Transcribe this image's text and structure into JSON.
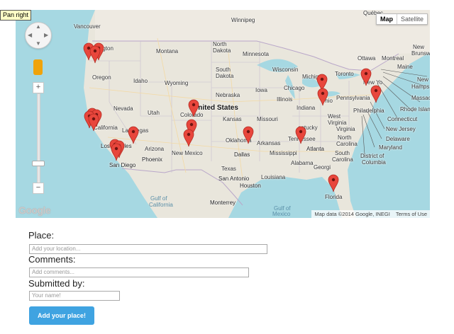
{
  "tooltip": "Pan right",
  "map": {
    "map_type_buttons": [
      "Map",
      "Satellite"
    ],
    "active_map_type": "Map",
    "google_logo": "Google",
    "attribution": "Map data ©2014 Google, INEGI",
    "terms": "Terms of Use",
    "zoom_in": "+",
    "zoom_out": "−",
    "country_label": "United States",
    "pin_color": "#e8463c",
    "water_color": "#a6d8e2",
    "land_color": "#e9e6dc",
    "labels": {
      "vancouver": "Vancouver",
      "winnipeg": "Winnipeg",
      "quebec": "Québec",
      "washington": "Washington",
      "montana": "Montana",
      "north_dakota_1": "North",
      "north_dakota_2": "Dakota",
      "minnesota": "Minnesota",
      "ottawa": "Ottawa",
      "montreal": "Montreal",
      "new_brunswick_1": "New",
      "new_brunswick_2": "Brunswi",
      "oregon": "Oregon",
      "idaho": "Idaho",
      "south_dakota_1": "South",
      "south_dakota_2": "Dakota",
      "wisconsin": "Wisconsin",
      "michigan": "Michig",
      "toronto": "Toronto",
      "maine": "Maine",
      "wyoming": "Wyoming",
      "iowa": "Iowa",
      "chicago": "Chicago",
      "new_york": "New Yo",
      "new_hampshire_1": "New",
      "new_hampshire_2": "Hamps",
      "massachusetts": "Massach",
      "nebraska": "Nebraska",
      "illinois": "Illinois",
      "ohio": "Ohio",
      "pennsylvania": "Pennsylvania",
      "rhode_island": "Rhode Islan",
      "nevada": "Nevada",
      "utah": "Utah",
      "colorado": "Colorado",
      "indiana": "Indiana",
      "philadelphia": "Philadelphia",
      "connecticut": "Connecticut",
      "kansas": "Kansas",
      "missouri": "Missouri",
      "west_virginia_1": "West",
      "west_virginia_2": "Virginia",
      "new_jersey": "New Jersey",
      "california": "California",
      "las_vegas": "Las Vegas",
      "kentucky": "entucky",
      "virginia": "Virginia",
      "delaware": "Delaware",
      "maryland": "Maryland",
      "los_angeles": "Los Angeles",
      "arizona": "Arizona",
      "new_mexico": "New Mexico",
      "oklahoma": "Oklahoma",
      "arkansas": "Arkansas",
      "tennessee": "Tennessee",
      "north_carolina_1": "North",
      "north_carolina_2": "Carolina",
      "phoenix": "Phoenix",
      "dallas": "Dallas",
      "mississippi": "Mississippi",
      "atlanta": "Atlanta",
      "south_carolina_1": "South",
      "south_carolina_2": "Carolina",
      "district_of_columbia_1": "District of",
      "district_of_columbia_2": "Columbia",
      "san_diego": "San Diego",
      "texas": "Texas",
      "alabama": "Alabama",
      "georgia": "Georgi",
      "louisiana": "Louisiana",
      "san_antonio": "San Antonio",
      "houston": "Houston",
      "florida": "Florida",
      "gulf_california_1": "Gulf of",
      "gulf_california_2": "California",
      "monterrey": "Monterrey",
      "gulf_mexico_1": "Gulf of",
      "gulf_mexico_2": "Mexico"
    }
  },
  "form": {
    "place_label": "Place:",
    "place_placeholder": "Add your location...",
    "comments_label": "Comments:",
    "comments_placeholder": "Add comments...",
    "submitted_label": "Submitted by:",
    "submitted_placeholder": "Your name!",
    "submit_label": "Add your place!"
  }
}
